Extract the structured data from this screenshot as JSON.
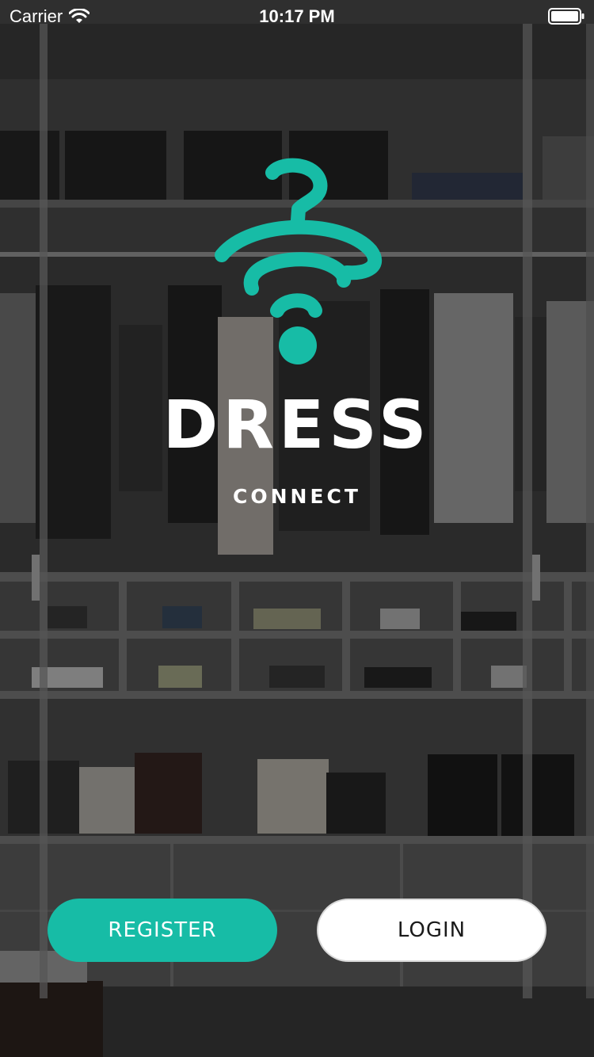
{
  "status_bar": {
    "carrier": "Carrier",
    "time": "10:17 PM",
    "wifi_icon": "wifi-icon",
    "battery_icon": "battery-icon"
  },
  "brand": {
    "logo_icon": "hanger-wifi-logo-icon",
    "title": "DRESS",
    "subtitle": "CONNECT"
  },
  "actions": {
    "register_label": "REGISTER",
    "login_label": "LOGIN"
  },
  "colors": {
    "accent": "#17bca6",
    "button_secondary_bg": "#ffffff",
    "text_light": "#ffffff",
    "background_overlay": "#2b2b2b"
  }
}
